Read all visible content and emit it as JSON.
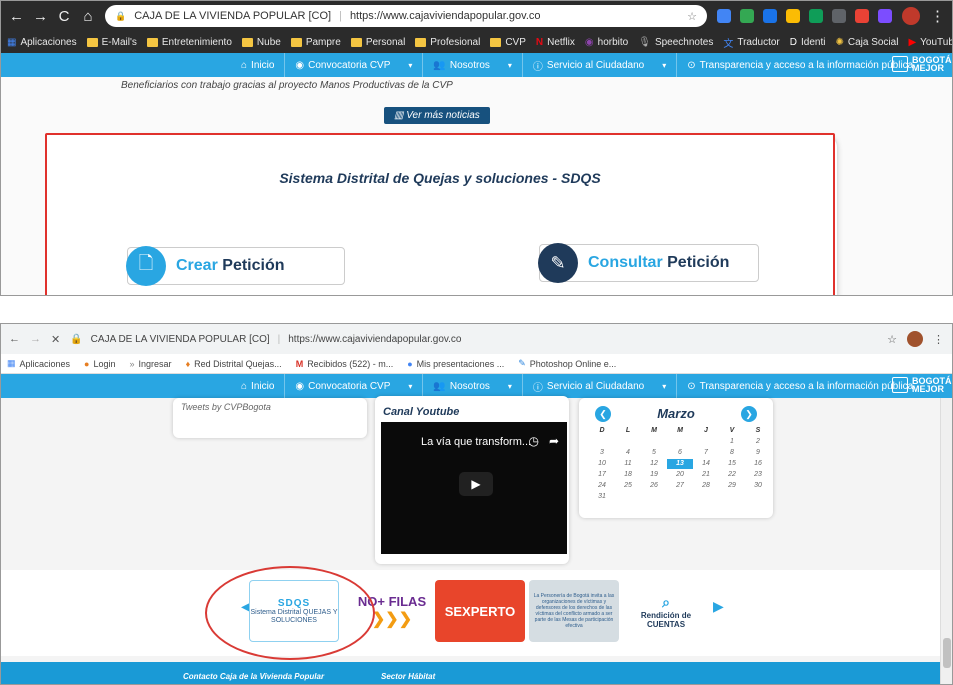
{
  "shot1": {
    "tab_title": "CAJA DE LA VIVIENDA POPULAR [CO]",
    "url": "https://www.cajaviviendapopular.gov.co",
    "bookmarks": [
      "Aplicaciones",
      "E-Mail's",
      "Entretenimiento",
      "Nube",
      "Pampre",
      "Personal",
      "Profesional",
      "CVP",
      "Netflix",
      "horbito",
      "Speechnotes",
      "Traductor",
      "Identi",
      "Caja Social",
      "YouTube"
    ],
    "nav": [
      "Inicio",
      "Convocatoria CVP",
      "Nosotros",
      "Servicio al Ciudadano",
      "Transparencia y acceso a la información pública"
    ],
    "note": "Beneficiarios con trabajo gracias al proyecto Manos Productivas de la CVP",
    "more_news": "Ver más noticias",
    "sdqs_title": "Sistema Distrital de Quejas y soluciones - SDQS",
    "crear": {
      "accent": "Crear",
      "rest": "Petición"
    },
    "consultar": {
      "accent": "Consultar",
      "rest": "Petición"
    },
    "logo_text": "BOGOTÁ MEJOR"
  },
  "shot2": {
    "tab_title": "CAJA DE LA VIVIENDA POPULAR [CO]",
    "url": "https://www.cajaviviendapopular.gov.co",
    "bookmarks": [
      "Aplicaciones",
      "Login",
      "Ingresar",
      "Red Distrital Quejas...",
      "Recibidos (522) - m...",
      "Mis presentaciones ...",
      "Photoshop Online e..."
    ],
    "tweets": "Tweets by CVPBogota",
    "youtube_title": "Canal Youtube",
    "video_caption": "La vía que transform...",
    "calendar_month": "Marzo",
    "calendar_dow": [
      "D",
      "L",
      "M",
      "M",
      "J",
      "V",
      "S"
    ],
    "calendar_days": [
      "",
      "",
      "",
      "",
      "",
      "1",
      "2",
      "3",
      "4",
      "5",
      "6",
      "7",
      "8",
      "9",
      "10",
      "11",
      "12",
      "13",
      "14",
      "15",
      "16",
      "17",
      "18",
      "19",
      "20",
      "21",
      "22",
      "23",
      "24",
      "25",
      "26",
      "27",
      "28",
      "29",
      "30",
      "31"
    ],
    "today": "13",
    "tiles": {
      "sdqs_big": "SDQS",
      "sdqs_small": "Sistema Distrital QUEJAS Y SOLUCIONES",
      "nofilas": "NO+ FILAS",
      "sexperto": "SEXPERTO",
      "personeria": "La Personería de Bogotá invita a las organizaciones de víctimas y defensores de los derechos de las víctimas del conflicto armado a ser parte de las Mesas de participación efectiva",
      "rendicion": "Rendición de CUENTAS"
    },
    "footer_left": "Contacto Caja de la Vivienda Popular",
    "footer_right": "Sector Hábitat"
  },
  "colors": {
    "accent": "#29a6e2",
    "navy": "#1f3a5a",
    "highlight_red": "#e0312c"
  }
}
